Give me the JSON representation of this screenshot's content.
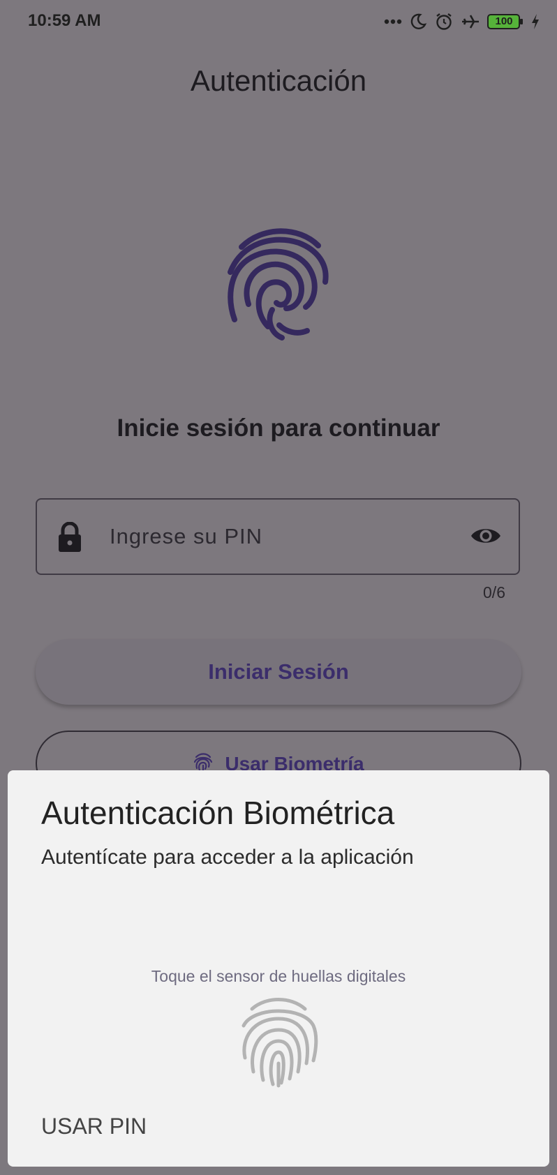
{
  "status_bar": {
    "time": "10:59 AM",
    "battery_level": "100",
    "icons": [
      "more-notifications-icon",
      "moon-icon",
      "alarm-icon",
      "airplane-icon",
      "battery-icon",
      "charging-bolt-icon"
    ]
  },
  "app": {
    "title": "Autenticación",
    "prompt": "Inicie sesión para continuar",
    "pin_field": {
      "placeholder": "Ingrese su PIN",
      "value": "",
      "counter": "0/6"
    },
    "login_button": "Iniciar Sesión",
    "biometric_button": "Usar Biometría"
  },
  "colors": {
    "scrim": "#7d787e",
    "accent": "#3b2d6b",
    "dialog_bg": "#f2f2f2"
  },
  "dialog": {
    "title": "Autenticación Biométrica",
    "subtitle": "Autentícate para acceder a la aplicación",
    "hint": "Toque el sensor de huellas digitales",
    "negative_button": "USAR PIN"
  }
}
